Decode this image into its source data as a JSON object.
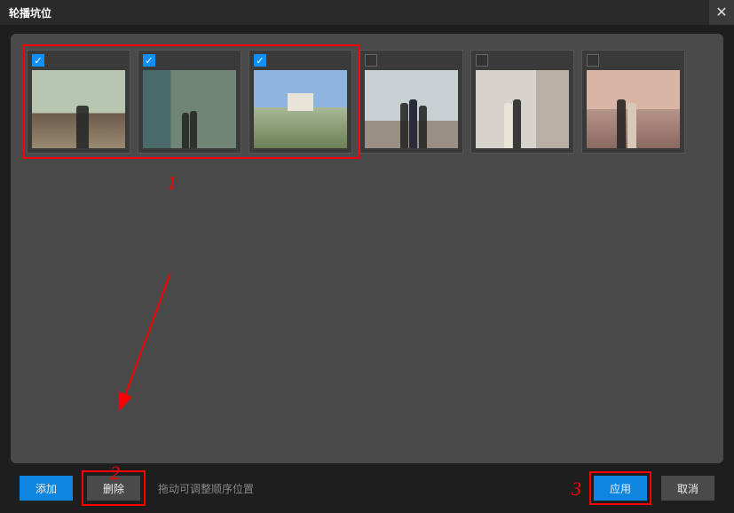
{
  "titlebar": {
    "title": "轮播坑位"
  },
  "thumbs": [
    {
      "checked": true
    },
    {
      "checked": true
    },
    {
      "checked": true
    },
    {
      "checked": false
    },
    {
      "checked": false
    },
    {
      "checked": false
    }
  ],
  "footer": {
    "add_label": "添加",
    "delete_label": "删除",
    "hint": "拖动可调整顺序位置",
    "apply_label": "应用",
    "cancel_label": "取消"
  },
  "annotations": {
    "marker1": "1",
    "marker2": "2",
    "marker3": "3"
  }
}
